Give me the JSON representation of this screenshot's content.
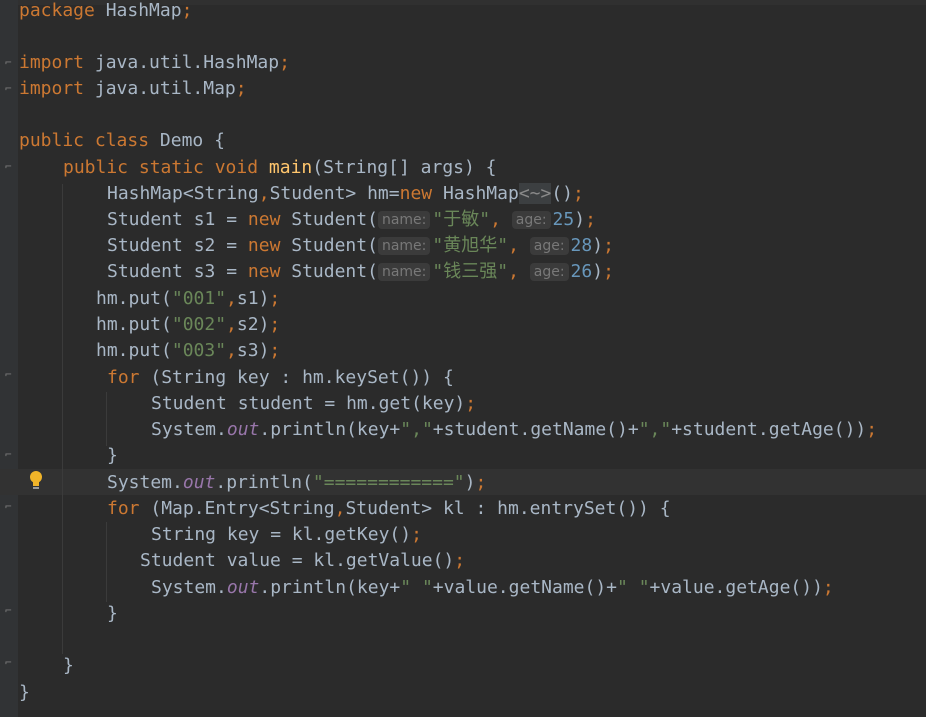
{
  "editor": {
    "lines": {
      "l1": {
        "kw": "package",
        "rest": " HashMap",
        "semi": ";"
      },
      "l3": {
        "kw": "import",
        "rest": " java.util.HashMap",
        "semi": ";"
      },
      "l4": {
        "kw": "import",
        "rest": " java.util.Map",
        "semi": ";"
      },
      "l6": {
        "kw1": "public",
        "kw2": "class",
        "rest": " Demo {"
      },
      "l7": {
        "kw": "public static void",
        "name": "main",
        "rest": "(String[] args) {"
      },
      "l8": {
        "a": "HashMap<String",
        "comma": ",",
        "b": "Student> hm=",
        "kw": "new",
        "c": " HashMap",
        "diamond": "<~>",
        "d": "()",
        "semi": ";"
      },
      "l9": {
        "a": "Student s1 = ",
        "kw": "new",
        "b": " Student(",
        "hint1": "name:",
        "str": "\"于敏\"",
        "comma": ",",
        "hint2": "age:",
        "num": "25",
        "c": ")",
        "semi": ";"
      },
      "l10": {
        "a": "Student s2 = ",
        "kw": "new",
        "b": " Student(",
        "hint1": "name:",
        "str": "\"黄旭华\"",
        "comma": ",",
        "hint2": "age:",
        "num": "28",
        "c": ")",
        "semi": ";"
      },
      "l11": {
        "a": "Student s3 = ",
        "kw": "new",
        "b": " Student(",
        "hint1": "name:",
        "str": "\"钱三强\"",
        "comma": ",",
        "hint2": "age:",
        "num": "26",
        "c": ")",
        "semi": ";"
      },
      "l12": {
        "a": "hm.put(",
        "str": "\"001\"",
        "comma": ",",
        "b": "s1)",
        "semi": ";"
      },
      "l13": {
        "a": "hm.put(",
        "str": "\"002\"",
        "comma": ",",
        "b": "s2)",
        "semi": ";"
      },
      "l14": {
        "a": "hm.put(",
        "str": "\"003\"",
        "comma": ",",
        "b": "s3)",
        "semi": ";"
      },
      "l15": {
        "kw": "for",
        "rest": " (String key : hm.keySet()) {"
      },
      "l16": {
        "a": "Student student = hm.get(key)",
        "semi": ";"
      },
      "l17": {
        "a": "System.",
        "it": "out",
        "b": ".println(key+",
        "s1": "\",\"",
        "c": "+student.getName()+",
        "s2": "\",\"",
        "d": "+student.getAge())",
        "semi": ";"
      },
      "l18": {
        "a": "}"
      },
      "l19": {
        "a": "System.",
        "it": "out",
        "b": ".println(",
        "str": "\"============\"",
        "c": ")",
        "semi": ";"
      },
      "l20": {
        "kw": "for",
        "a": " (Map.Entry<String",
        "comma": ",",
        "b": "Student> kl : hm.entrySet()) {"
      },
      "l21": {
        "a": "String key = kl.getKey()",
        "semi": ";"
      },
      "l22": {
        "a": "Student value = kl.getValue()",
        "semi": ";"
      },
      "l23": {
        "a": "System.",
        "it": "out",
        "b": ".println(key+",
        "s1": "\" \"",
        "c": "+value.getName()+",
        "s2": "\" \"",
        "d": "+value.getAge())",
        "semi": ";"
      },
      "l24": {
        "a": "}"
      },
      "l26": {
        "a": "}"
      },
      "l27": {
        "a": "}"
      }
    }
  }
}
